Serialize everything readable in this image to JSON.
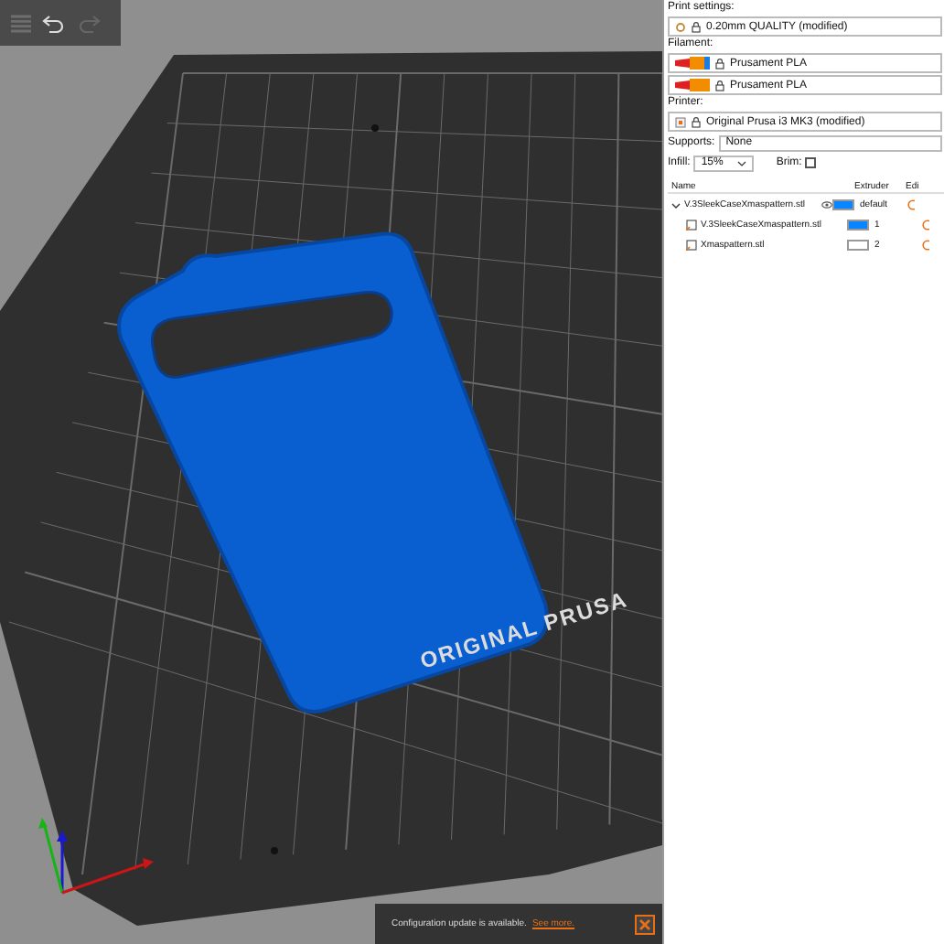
{
  "toolbar": {
    "undo_enabled": true,
    "redo_enabled": false
  },
  "bed": {
    "label": "ORIGINAL PRUSA"
  },
  "notification": {
    "text": "Configuration update is available.",
    "link": "See more."
  },
  "sidebar": {
    "print_settings": {
      "label": "Print settings:",
      "value": "0.20mm QUALITY (modified)"
    },
    "filament": {
      "label": "Filament:",
      "items": [
        {
          "name": "Prusament PLA",
          "color": "#f28c00",
          "selected": true
        },
        {
          "name": "Prusament PLA",
          "color": "#f28c00",
          "selected": false
        }
      ]
    },
    "printer": {
      "label": "Printer:",
      "value": "Original Prusa i3 MK3 (modified)"
    },
    "supports": {
      "label": "Supports:",
      "value": "None"
    },
    "infill": {
      "label": "Infill:",
      "value": "15%"
    },
    "brim": {
      "label": "Brim:",
      "checked": false
    },
    "object_list": {
      "columns": [
        "Name",
        "Extruder",
        "Edi"
      ],
      "rows": [
        {
          "name": "V.3SleekCaseXmaspattern.stl",
          "extruder": "default",
          "color": "#0a84ff",
          "expanded": true,
          "children": [
            {
              "name": "V.3SleekCaseXmaspattern.stl",
              "extruder": "1",
              "color": "#0a84ff"
            },
            {
              "name": "Xmaspattern.stl",
              "extruder": "2",
              "color": "#ffffff"
            }
          ]
        }
      ]
    }
  }
}
